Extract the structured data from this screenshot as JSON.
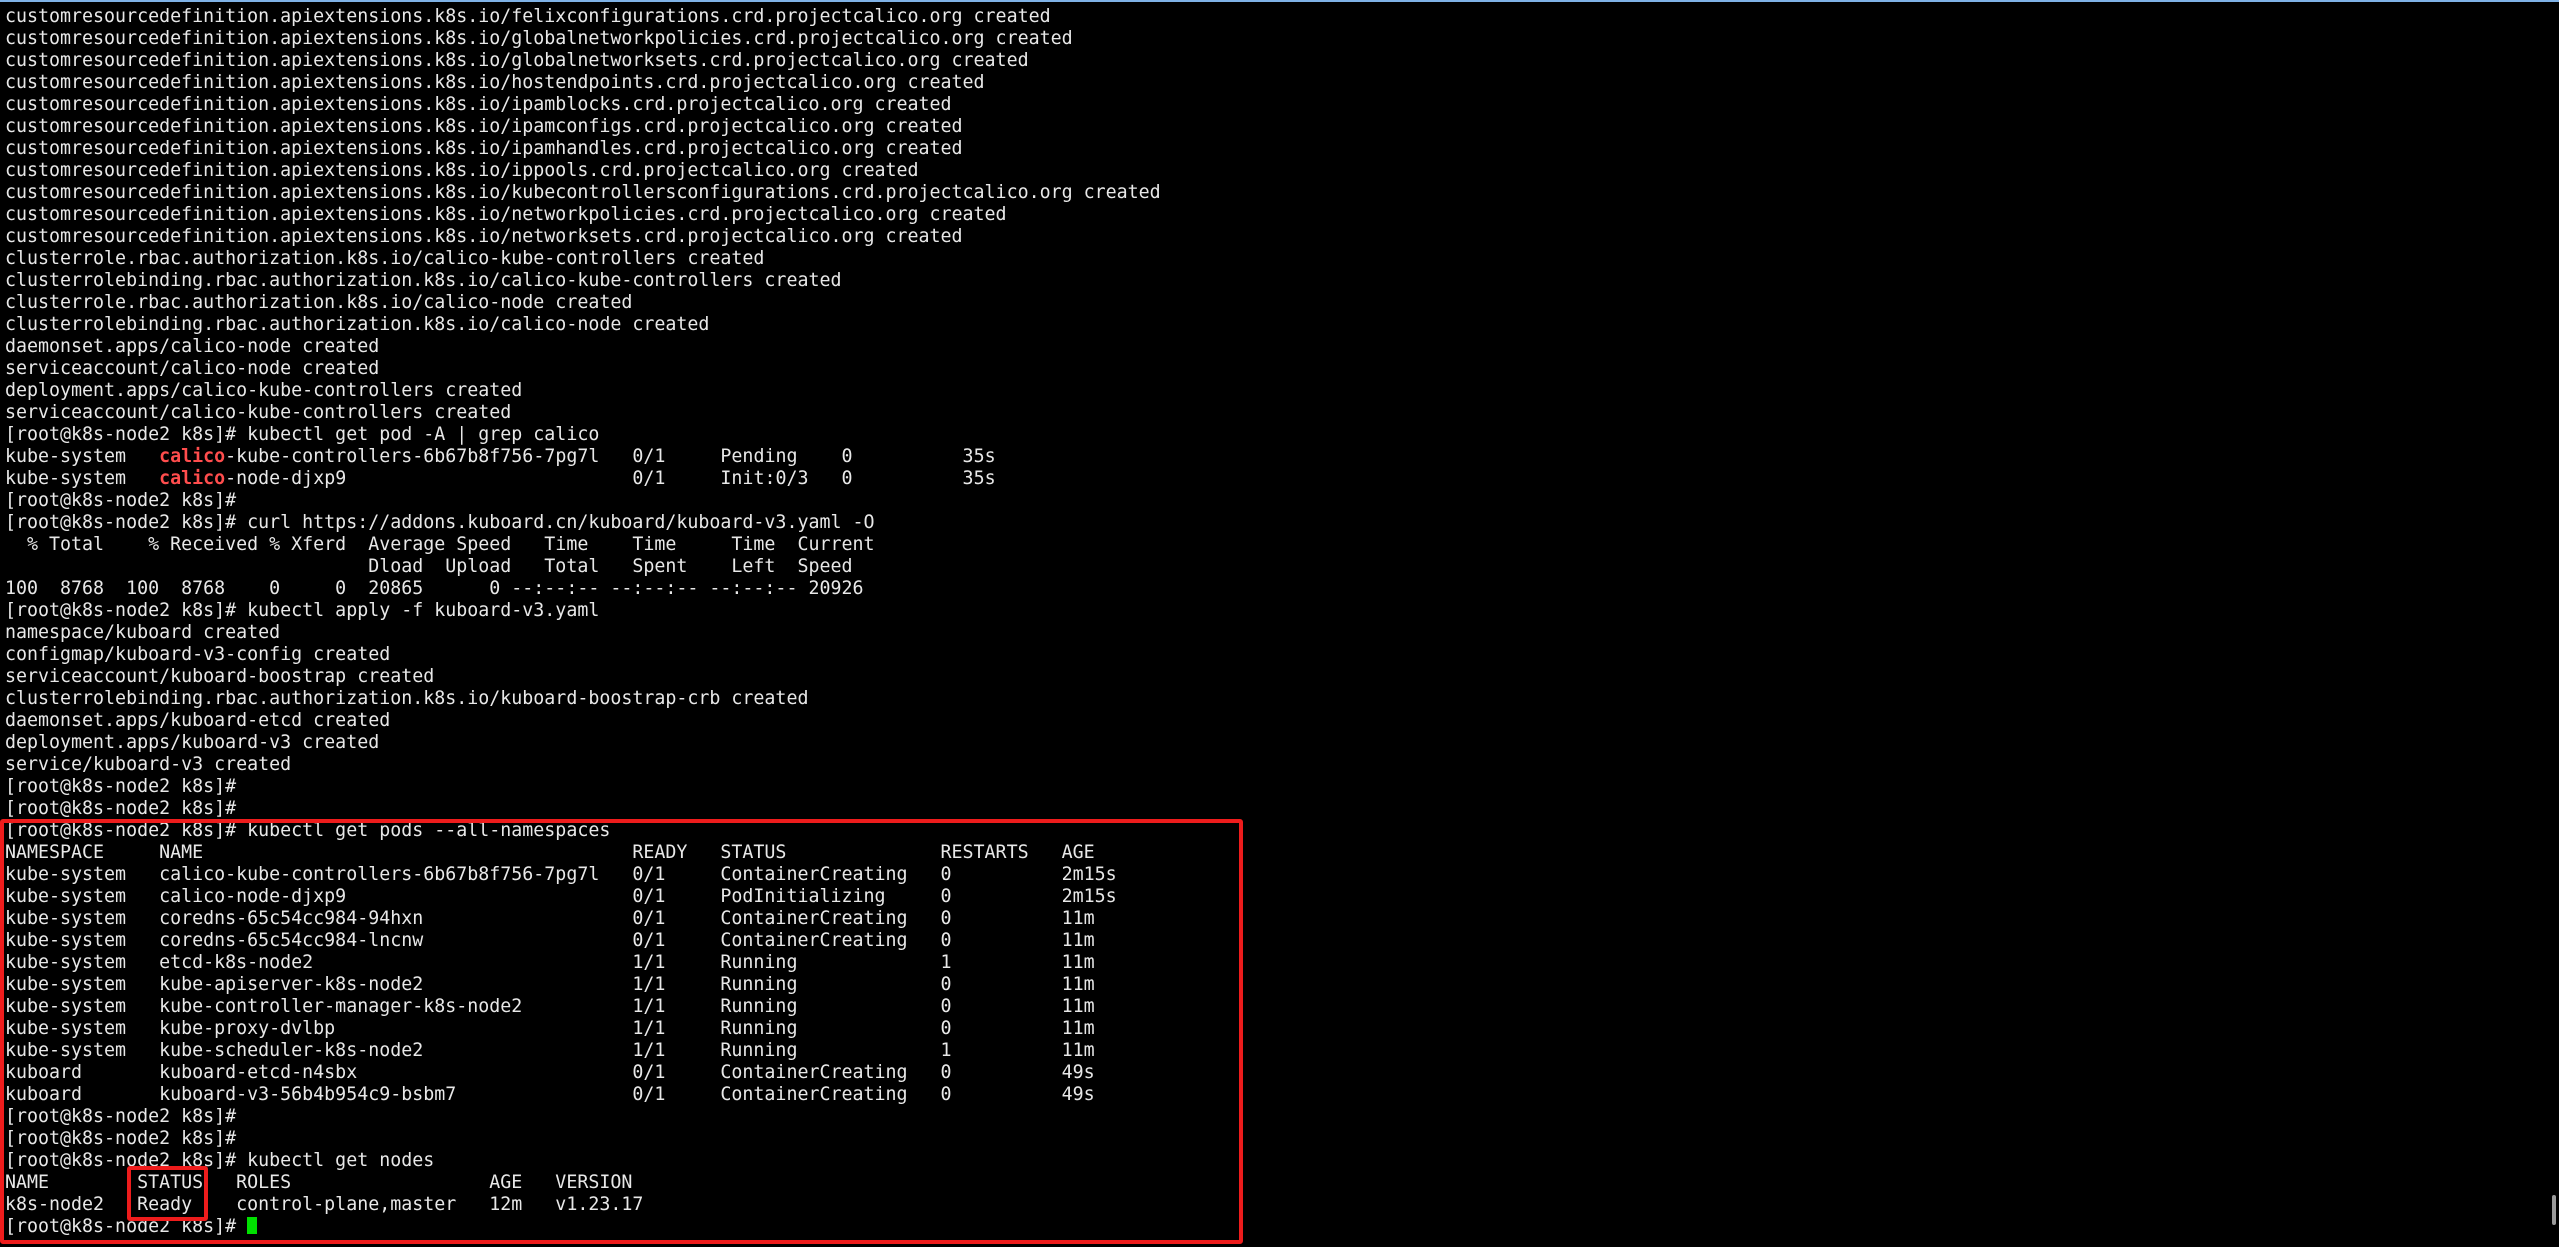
{
  "terminal": {
    "lines": [
      "customresourcedefinition.apiextensions.k8s.io/felixconfigurations.crd.projectcalico.org created",
      "customresourcedefinition.apiextensions.k8s.io/globalnetworkpolicies.crd.projectcalico.org created",
      "customresourcedefinition.apiextensions.k8s.io/globalnetworksets.crd.projectcalico.org created",
      "customresourcedefinition.apiextensions.k8s.io/hostendpoints.crd.projectcalico.org created",
      "customresourcedefinition.apiextensions.k8s.io/ipamblocks.crd.projectcalico.org created",
      "customresourcedefinition.apiextensions.k8s.io/ipamconfigs.crd.projectcalico.org created",
      "customresourcedefinition.apiextensions.k8s.io/ipamhandles.crd.projectcalico.org created",
      "customresourcedefinition.apiextensions.k8s.io/ippools.crd.projectcalico.org created",
      "customresourcedefinition.apiextensions.k8s.io/kubecontrollersconfigurations.crd.projectcalico.org created",
      "customresourcedefinition.apiextensions.k8s.io/networkpolicies.crd.projectcalico.org created",
      "customresourcedefinition.apiextensions.k8s.io/networksets.crd.projectcalico.org created",
      "clusterrole.rbac.authorization.k8s.io/calico-kube-controllers created",
      "clusterrolebinding.rbac.authorization.k8s.io/calico-kube-controllers created",
      "clusterrole.rbac.authorization.k8s.io/calico-node created",
      "clusterrolebinding.rbac.authorization.k8s.io/calico-node created",
      "daemonset.apps/calico-node created",
      "serviceaccount/calico-node created",
      "deployment.apps/calico-kube-controllers created",
      "serviceaccount/calico-kube-controllers created",
      "[root@k8s-node2 k8s]# kubectl get pod -A | grep calico",
      "kube-system   calico-kube-controllers-6b67b8f756-7pg7l   0/1     Pending    0          35s",
      "kube-system   calico-node-djxp9                          0/1     Init:0/3   0          35s",
      "[root@k8s-node2 k8s]#",
      "[root@k8s-node2 k8s]# curl https://addons.kuboard.cn/kuboard/kuboard-v3.yaml -O",
      "  % Total    % Received % Xferd  Average Speed   Time    Time     Time  Current",
      "                                 Dload  Upload   Total   Spent    Left  Speed",
      "100  8768  100  8768    0     0  20865      0 --:--:-- --:--:-- --:--:-- 20926",
      "[root@k8s-node2 k8s]# kubectl apply -f kuboard-v3.yaml",
      "namespace/kuboard created",
      "configmap/kuboard-v3-config created",
      "serviceaccount/kuboard-boostrap created",
      "clusterrolebinding.rbac.authorization.k8s.io/kuboard-boostrap-crb created",
      "daemonset.apps/kuboard-etcd created",
      "deployment.apps/kuboard-v3 created",
      "service/kuboard-v3 created",
      "[root@k8s-node2 k8s]#",
      "[root@k8s-node2 k8s]#",
      "[root@k8s-node2 k8s]# kubectl get pods --all-namespaces",
      "NAMESPACE     NAME                                       READY   STATUS              RESTARTS   AGE",
      "kube-system   calico-kube-controllers-6b67b8f756-7pg7l   0/1     ContainerCreating   0          2m15s",
      "kube-system   calico-node-djxp9                          0/1     PodInitializing     0          2m15s",
      "kube-system   coredns-65c54cc984-94hxn                   0/1     ContainerCreating   0          11m",
      "kube-system   coredns-65c54cc984-lncnw                   0/1     ContainerCreating   0          11m",
      "kube-system   etcd-k8s-node2                             1/1     Running             1          11m",
      "kube-system   kube-apiserver-k8s-node2                   1/1     Running             0          11m",
      "kube-system   kube-controller-manager-k8s-node2          1/1     Running             0          11m",
      "kube-system   kube-proxy-dvlbp                           1/1     Running             0          11m",
      "kube-system   kube-scheduler-k8s-node2                   1/1     Running             1          11m",
      "kuboard       kuboard-etcd-n4sbx                         0/1     ContainerCreating   0          49s",
      "kuboard       kuboard-v3-56b4b954c9-bsbm7                0/1     ContainerCreating   0          49s",
      "[root@k8s-node2 k8s]#",
      "[root@k8s-node2 k8s]#",
      "[root@k8s-node2 k8s]# kubectl get nodes",
      "NAME        STATUS   ROLES                  AGE   VERSION",
      "k8s-node2   Ready    control-plane,master   12m   v1.23.17"
    ],
    "calico_lines": [
      {
        "pre": "kube-system   ",
        "hl": "calico",
        "post": "-kube-controllers-6b67b8f756-7pg7l   0/1     Pending    0          35s"
      },
      {
        "pre": "kube-system   ",
        "hl": "calico",
        "post": "-node-djxp9                          0/1     Init:0/3   0          35s"
      }
    ],
    "prompt": "[root@k8s-node2 k8s]# ",
    "colors": {
      "background": "#000000",
      "text": "#e8e8e8",
      "highlight": "#ff4d4d",
      "cursor": "#00e000",
      "annotation": "#ee1c1c"
    }
  }
}
